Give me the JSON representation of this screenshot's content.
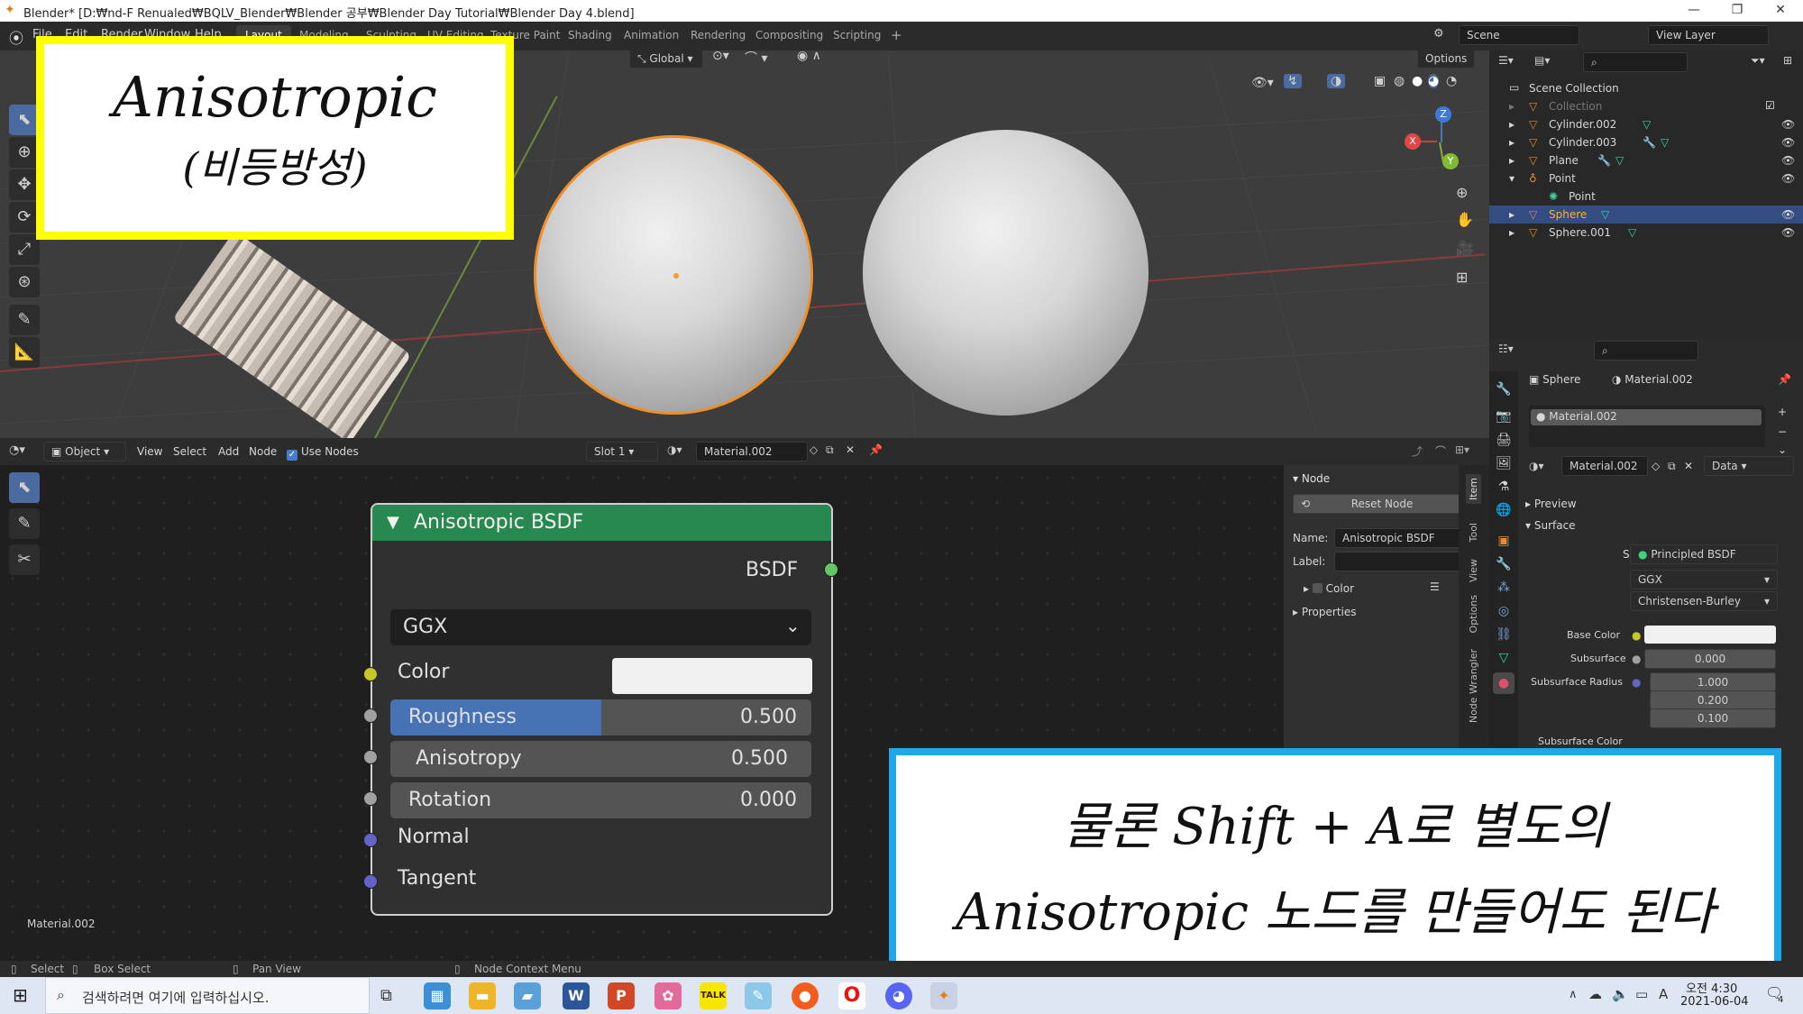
{
  "window": {
    "title": "Blender* [D:₩nd-F Renualed₩BQLV_Blender₩Blender 공부₩Blender Day Tutorial₩Blender Day 4.blend]",
    "minimize": "—",
    "maximize": "❐",
    "close": "✕"
  },
  "topbar": {
    "menus": [
      "File",
      "Edit",
      "Render",
      "Window",
      "Help"
    ],
    "workspaces": [
      "Layout",
      "Modeling",
      "Sculpting",
      "UV Editing",
      "Texture Paint",
      "Shading",
      "Animation",
      "Rendering",
      "Compositing",
      "Scripting"
    ],
    "add_tab": "+",
    "scene": "Scene",
    "view_layer": "View Layer"
  },
  "viewport": {
    "orientation": "Global",
    "options": "Options",
    "gizmo": {
      "x": "X",
      "y": "Y",
      "z": "Z"
    }
  },
  "callout_top": {
    "line1": "Anisotropic",
    "line2": "(비등방성)"
  },
  "callout_bottom": {
    "line1": "물론 Shift + A로 별도의",
    "line2": "Anisotropic 노드를 만들어도 된다"
  },
  "node_header": {
    "mode": "Object",
    "menus": [
      "View",
      "Select",
      "Add",
      "Node"
    ],
    "use_nodes": "Use Nodes",
    "slot": "Slot 1",
    "material": "Material.002"
  },
  "node": {
    "title": "Anisotropic BSDF",
    "output": "BSDF",
    "distribution": "GGX",
    "color_label": "Color",
    "roughness_label": "Roughness",
    "roughness_value": "0.500",
    "roughness_fraction": 0.5,
    "anisotropy_label": "Anisotropy",
    "anisotropy_value": "0.500",
    "rotation_label": "Rotation",
    "rotation_value": "0.000",
    "normal_label": "Normal",
    "tangent_label": "Tangent",
    "colors": {
      "header": "#27894f",
      "color_socket": "#c7c729",
      "float_socket": "#a1a1a1",
      "vector_socket": "#6363c7",
      "shader_socket": "#63c763"
    }
  },
  "node_area": {
    "material_label": "Material.002"
  },
  "npanel": {
    "section": "Node",
    "reset": "Reset Node",
    "name_label": "Name:",
    "name_value": "Anisotropic BSDF",
    "label_label": "Label:",
    "color": "Color",
    "properties": "Properties",
    "tabs": [
      "Item",
      "Tool",
      "View",
      "Options",
      "Node Wrangler"
    ]
  },
  "outliner": {
    "root": "Scene Collection",
    "items": [
      {
        "name": "Collection",
        "dim": true
      },
      {
        "name": "Cylinder.002"
      },
      {
        "name": "Cylinder.003"
      },
      {
        "name": "Plane"
      },
      {
        "name": "Point"
      },
      {
        "name": "Point",
        "child": true
      },
      {
        "name": "Sphere",
        "selected": true
      },
      {
        "name": "Sphere.001"
      }
    ]
  },
  "properties": {
    "object": "Sphere",
    "material": "Material.002",
    "slot_material": "Material.002",
    "data": "Data",
    "preview": "Preview",
    "surface": "Surface",
    "surface_label": "Surface",
    "surface_value": "Principled BSDF",
    "distribution": "GGX",
    "subsurface_method": "Christensen-Burley",
    "base_color_label": "Base Color",
    "subsurface_label": "Subsurface",
    "subsurface_value": "0.000",
    "subsurface_radius_label": "Subsurface Radius",
    "radius": [
      "1.000",
      "0.200",
      "0.100"
    ],
    "subsurface_color_label": "Subsurface Color"
  },
  "statusbar": {
    "select": "Select",
    "box_select": "Box Select",
    "pan_view": "Pan View",
    "context_menu": "Node Context Menu"
  },
  "taskbar": {
    "search_placeholder": "검색하려면 여기에 입력하십시오.",
    "time": "오전 4:30",
    "date": "2021-06-04",
    "notification_count": "4",
    "lang": "A"
  }
}
